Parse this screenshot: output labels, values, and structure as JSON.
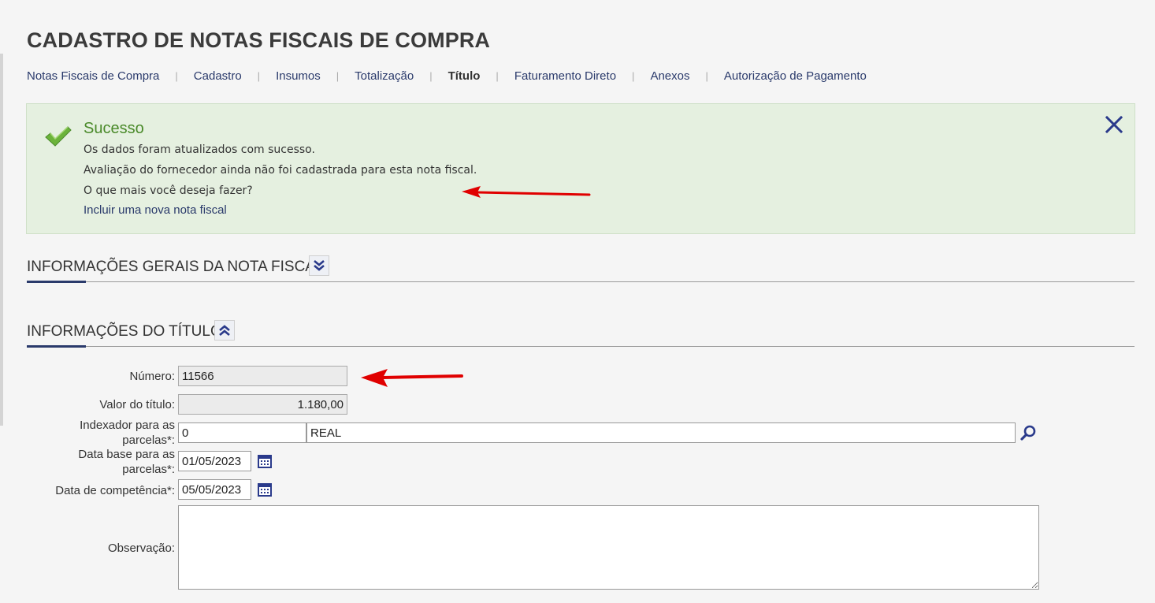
{
  "page": {
    "title": "CADASTRO DE NOTAS FISCAIS DE COMPRA"
  },
  "tabs": [
    {
      "label": "Notas Fiscais de Compra",
      "active": false
    },
    {
      "label": "Cadastro",
      "active": false
    },
    {
      "label": "Insumos",
      "active": false
    },
    {
      "label": "Totalização",
      "active": false
    },
    {
      "label": "Título",
      "active": true
    },
    {
      "label": "Faturamento Direto",
      "active": false
    },
    {
      "label": "Anexos",
      "active": false
    },
    {
      "label": "Autorização de Pagamento",
      "active": false
    }
  ],
  "alert": {
    "title": "Sucesso",
    "line1": "Os dados foram atualizados com sucesso.",
    "line2": "Avaliação do fornecedor ainda não foi cadastrada para esta nota fiscal.",
    "line3": "O que mais você deseja fazer?",
    "link": "Incluir uma nova nota fiscal",
    "icon": "check-icon",
    "close_icon": "close-icon",
    "bg_color": "#e5f0e0",
    "title_color": "#4a8a2a"
  },
  "sections": {
    "general": {
      "title": "INFORMAÇÕES GERAIS DA NOTA FISCAL",
      "toggle_icon": "chevron-double-down-icon"
    },
    "title_info": {
      "title": "INFORMAÇÕES DO TÍTULO",
      "toggle_icon": "chevron-double-up-icon"
    }
  },
  "form": {
    "numero": {
      "label": "Número:",
      "value": "11566"
    },
    "valor": {
      "label": "Valor do título:",
      "value": "1.180,00"
    },
    "indexador": {
      "label_line1": "Indexador para as",
      "label_line2": "parcelas*:",
      "code": "0",
      "description": "REAL"
    },
    "data_base": {
      "label_line1": "Data base para as",
      "label_line2": "parcelas*:",
      "value": "01/05/2023"
    },
    "data_competencia": {
      "label": "Data de competência*:",
      "value": "05/05/2023"
    },
    "observacao": {
      "label": "Observação:",
      "value": ""
    }
  },
  "colors": {
    "accent": "#2a3a6b",
    "annotation_arrow": "#e00000"
  }
}
